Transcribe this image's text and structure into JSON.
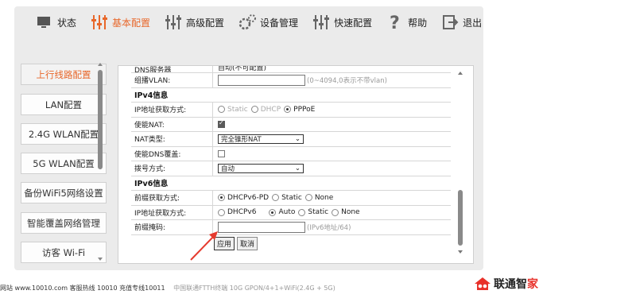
{
  "nav": [
    {
      "label": "状态",
      "icon": "monitor-icon",
      "active": false
    },
    {
      "label": "基本配置",
      "icon": "sliders-icon",
      "active": true
    },
    {
      "label": "高级配置",
      "icon": "sliders-icon",
      "active": false
    },
    {
      "label": "设备管理",
      "icon": "gears-icon",
      "active": false
    },
    {
      "label": "快速配置",
      "icon": "sliders-icon",
      "active": false
    },
    {
      "label": "帮助",
      "icon": "question-icon",
      "active": false
    },
    {
      "label": "退出",
      "icon": "exit-icon",
      "active": false
    }
  ],
  "sidebar": {
    "items": [
      {
        "label": "上行线路配置",
        "active": true
      },
      {
        "label": "LAN配置",
        "active": false
      },
      {
        "label": "2.4G WLAN配置",
        "active": false
      },
      {
        "label": "5G WLAN配置",
        "active": false
      },
      {
        "label": "备份WiFi5网络设置",
        "active": false
      },
      {
        "label": "智能覆盖网络管理",
        "active": false
      },
      {
        "label": "访客 Wi-Fi",
        "active": false
      }
    ]
  },
  "form": {
    "cut_row": {
      "label": "DNS服务器",
      "value": "自动(不可配置)"
    },
    "multicast_vlan": {
      "label": "组播VLAN:",
      "value": "",
      "hint": "(0~4094,0表示不带vlan)"
    },
    "ipv4_section": "IPv4信息",
    "ipv4_mode": {
      "label": "IP地址获取方式:",
      "options": [
        "Static",
        "DHCP",
        "PPPoE"
      ],
      "selected": "PPPoE"
    },
    "nat_enable": {
      "label": "使能NAT:",
      "checked": true
    },
    "nat_type": {
      "label": "NAT类型:",
      "value": "完全锥形NAT"
    },
    "dns_override": {
      "label": "使能DNS覆盖:",
      "checked": false
    },
    "dial_mode": {
      "label": "拨号方式:",
      "value": "自动"
    },
    "ipv6_section": "IPv6信息",
    "prefix_mode": {
      "label": "前缀获取方式:",
      "options": [
        "DHCPv6-PD",
        "Static",
        "None"
      ],
      "selected": "DHCPv6-PD"
    },
    "ipv6_mode": {
      "label": "IP地址获取方式:",
      "options": [
        "DHCPv6",
        "Auto",
        "Static",
        "None"
      ],
      "selected": "Auto"
    },
    "prefix_mask": {
      "label": "前缀掩码:",
      "value": "",
      "hint": "(IPv6地址/64)"
    },
    "apply_label": "应用",
    "cancel_label": "取消"
  },
  "footer": {
    "contact": "网站 www.10010.com  客服热线  10010  充值专线10011",
    "product": "中国联通FTTH终端 10G GPON/4+1+WiFi(2.4G + 5G)"
  },
  "logo": {
    "text": "联通智",
    "accent": "家"
  },
  "colors": {
    "accent": "#e8672a",
    "arrow": "#e53a2e"
  }
}
